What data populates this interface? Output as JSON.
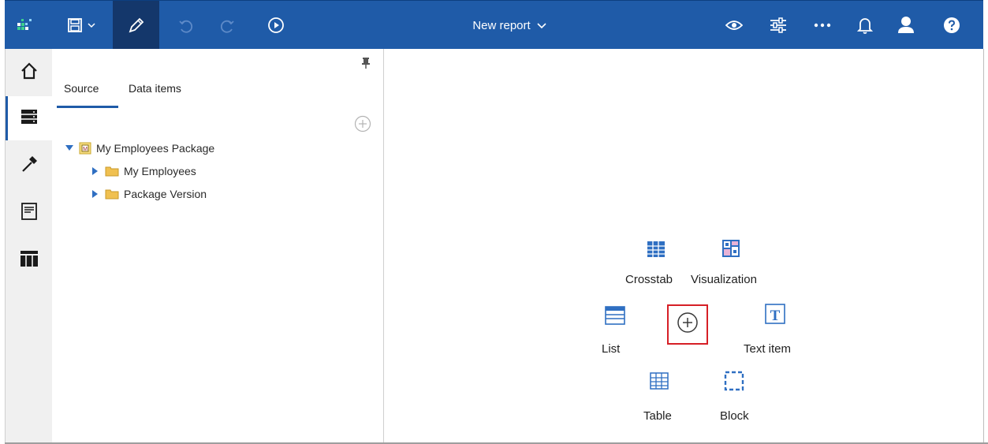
{
  "topbar": {
    "title": "New report",
    "icons": [
      "app-grid-logo-icon",
      "save-icon",
      "chevron-down-icon",
      "edit-pencil-icon",
      "undo-icon",
      "redo-icon",
      "run-play-icon",
      "chevron-down-icon",
      "preview-eye-icon",
      "sliders-icon",
      "more-icon",
      "notifications-bell-icon",
      "user-icon",
      "help-icon"
    ]
  },
  "rail": {
    "icons": [
      "home-icon",
      "data-source-icon",
      "toolbox-hammer-icon",
      "report-page-icon",
      "pages-layout-icon"
    ],
    "active": "data-source-icon"
  },
  "panel": {
    "tabs": [
      {
        "label": "Source",
        "active": true
      },
      {
        "label": "Data items",
        "active": false
      }
    ],
    "tree": [
      {
        "label": "My Employees Package",
        "icon": "package-icon",
        "expanded": true,
        "level": 0
      },
      {
        "label": "My Employees",
        "icon": "folder-icon",
        "expanded": false,
        "level": 1
      },
      {
        "label": "Package Version",
        "icon": "folder-icon",
        "expanded": false,
        "level": 1
      }
    ]
  },
  "canvas": {
    "tools": {
      "crosstab": "Crosstab",
      "visualization": "Visualization",
      "list": "List",
      "text_item": "Text item",
      "table": "Table",
      "block": "Block"
    },
    "add_icon": "add-circle-icon"
  },
  "colors": {
    "topbar": "#1f5ba8",
    "topbar_active": "#14376b",
    "accent": "#1f5ba8",
    "highlight_border": "#d61f26"
  }
}
